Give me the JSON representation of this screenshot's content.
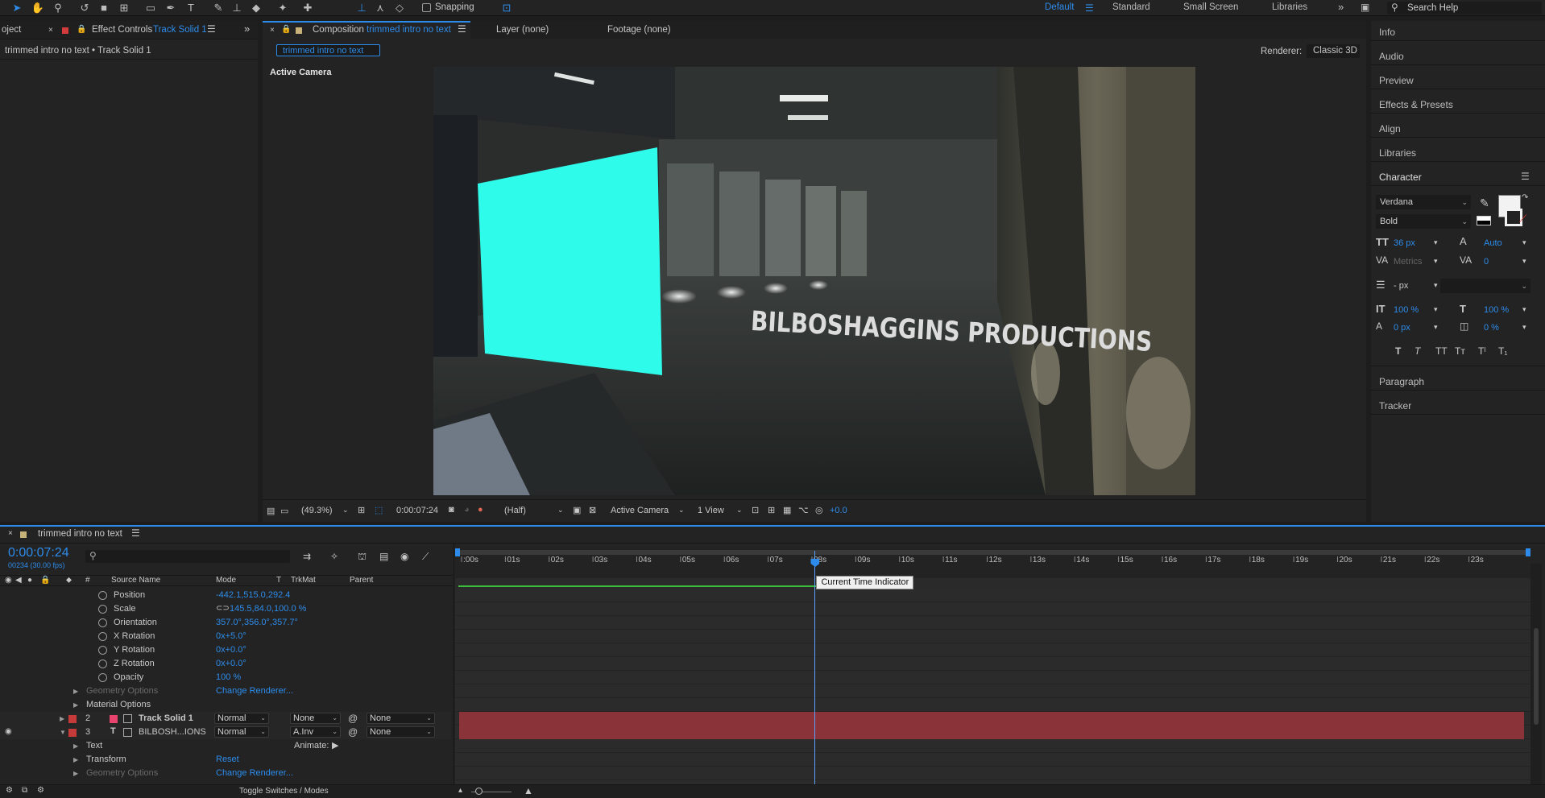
{
  "toolbar": {
    "snapping_label": "Snapping",
    "workspaces": [
      {
        "label": "Default",
        "active": true
      },
      {
        "label": "Standard",
        "active": false
      },
      {
        "label": "Small Screen",
        "active": false
      },
      {
        "label": "Libraries",
        "active": false
      }
    ],
    "search_placeholder": "Search Help"
  },
  "left_panel": {
    "tab_project_partial": "oject",
    "tab_effect_controls": "Effect Controls",
    "tab_effect_layer": "Track Solid 1",
    "subtitle": "trimmed intro no text • Track Solid 1"
  },
  "comp_panel": {
    "tab_composition": "Composition",
    "tab_comp_name": "trimmed intro no text",
    "tab_layer": "Layer (none)",
    "tab_footage": "Footage (none)",
    "breadcrumb": "trimmed intro no text",
    "renderer_label": "Renderer:",
    "renderer_value": "Classic 3D",
    "view_label": "Active Camera",
    "viewer_text": "BILBOSHAGGINS PRODUCTIONS",
    "bottom_bar": {
      "zoom": "(49.3%)",
      "timecode": "0:00:07:24",
      "resolution": "(Half)",
      "camera": "Active Camera",
      "views": "1 View",
      "exposure": "+0.0"
    }
  },
  "right_panel": {
    "items_top": [
      "Info",
      "Audio",
      "Preview",
      "Effects & Presets",
      "Align",
      "Libraries"
    ],
    "character": {
      "title": "Character",
      "font": "Verdana",
      "style": "Bold",
      "size": "36 px",
      "leading": "Auto",
      "kerning": "Metrics",
      "tracking": "0",
      "stroke": "- px",
      "vscale": "100 %",
      "hscale": "100 %",
      "baseline": "0 px",
      "tsume": "0 %"
    },
    "items_bottom": [
      "Paragraph",
      "Tracker"
    ]
  },
  "timeline": {
    "tab_name": "trimmed intro no text",
    "timecode": "0:00:07:24",
    "frame_info": "00234 (30.00 fps)",
    "columns": [
      "#",
      "Source Name",
      "Mode",
      "T",
      "TrkMat",
      "Parent"
    ],
    "properties": [
      {
        "name": "Position",
        "value": "-442.1,515.0,292.4"
      },
      {
        "name": "Scale",
        "value": "145.5,84.0,100.0 %"
      },
      {
        "name": "Orientation",
        "value": "357.0°,356.0°,357.7°"
      },
      {
        "name": "X Rotation",
        "value": "0x+5.0°"
      },
      {
        "name": "Y Rotation",
        "value": "0x+0.0°"
      },
      {
        "name": "Z Rotation",
        "value": "0x+0.0°"
      },
      {
        "name": "Opacity",
        "value": "100 %"
      }
    ],
    "geometry_options": "Geometry Options",
    "change_renderer": "Change Renderer...",
    "material_options": "Material Options",
    "layers": [
      {
        "num": "2",
        "name": "Track Solid 1",
        "mode": "Normal",
        "trkmat": "None",
        "parent": "None",
        "color": "#e8436f"
      },
      {
        "num": "3",
        "name": "BILBOSH...IONS",
        "mode": "Normal",
        "trkmat": "A.Inv",
        "parent": "None",
        "color": "#c73a3a"
      }
    ],
    "text_label": "Text",
    "animate_label": "Animate:",
    "transform_label": "Transform",
    "reset_label": "Reset",
    "toggle_label": "Toggle Switches / Modes",
    "tooltip": "Current Time Indicator",
    "ticks": [
      ":00s",
      "01s",
      "02s",
      "03s",
      "04s",
      "05s",
      "06s",
      "07s",
      "08s",
      "09s",
      "10s",
      "11s",
      "12s",
      "13s",
      "14s",
      "15s",
      "16s",
      "17s",
      "18s",
      "19s",
      "20s",
      "21s",
      "22s",
      "23s"
    ],
    "current_time_fraction": 0.336
  },
  "colors": {
    "accent": "#2d8ceb",
    "layer_bar": "#8a3338",
    "cyan_solid": "#2ffbea"
  }
}
